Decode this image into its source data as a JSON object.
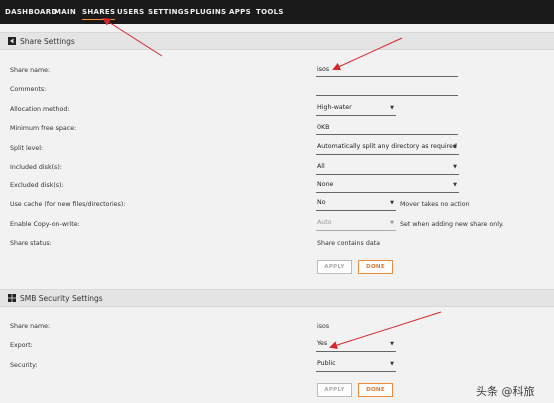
{
  "nav": {
    "items": [
      "DASHBOARD",
      "MAIN",
      "SHARES",
      "USERS",
      "SETTINGS",
      "PLUGINS",
      "APPS",
      "TOOLS"
    ],
    "active": "SHARES",
    "accent_color": "#ff8c2f"
  },
  "share_settings": {
    "title": "Share Settings",
    "icon": "share-icon",
    "share_name": {
      "label": "Share name:",
      "value": "isos"
    },
    "comments": {
      "label": "Comments:",
      "value": ""
    },
    "allocation": {
      "label": "Allocation method:",
      "value": "High-water"
    },
    "min_free": {
      "label": "Minimum free space:",
      "value": "0KB"
    },
    "split_level": {
      "label": "Split level:",
      "value": "Automatically split any directory as required"
    },
    "included": {
      "label": "Included disk(s):",
      "value": "All"
    },
    "excluded": {
      "label": "Excluded disk(s):",
      "value": "None"
    },
    "use_cache": {
      "label": "Use cache (for new files/directories):",
      "value": "No",
      "hint": "Mover takes no action"
    },
    "cow": {
      "label": "Enable Copy-on-write:",
      "value": "Auto",
      "hint": "Set when adding new share only."
    },
    "status": {
      "label": "Share status:",
      "value": "Share contains data"
    },
    "apply_label": "APPLY",
    "done_label": "DONE"
  },
  "smb_settings": {
    "title": "SMB Security Settings",
    "icon": "windows-icon",
    "share_name": {
      "label": "Share name:",
      "value": "isos"
    },
    "export": {
      "label": "Export:",
      "value": "Yes"
    },
    "security": {
      "label": "Security:",
      "value": "Public"
    },
    "apply_label": "APPLY",
    "done_label": "DONE"
  },
  "watermark": "头条 @科旅",
  "annotation_color": "#d9262b"
}
